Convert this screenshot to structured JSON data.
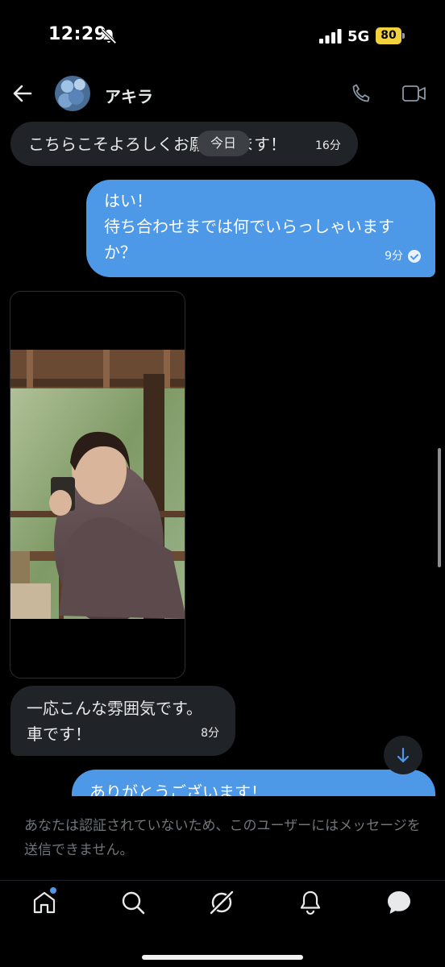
{
  "status_bar": {
    "time": "12:29",
    "network": "5G",
    "battery": "80",
    "mute_icon": "bell-slash-icon",
    "signal_icon": "cellular-signal-icon",
    "battery_color": "#f2d23c"
  },
  "header": {
    "contact_name": "アキラ",
    "back_icon": "arrow-left-icon",
    "call_icon": "phone-icon",
    "video_icon": "video-camera-icon"
  },
  "conversation": {
    "date_separator": "今日",
    "messages": [
      {
        "direction": "incoming",
        "text": "こちらこそよろしくお願いします！",
        "time": "16分"
      },
      {
        "direction": "outgoing",
        "lines": [
          "はい！",
          "待ち合わせまでは何でいらっしゃいます",
          "か？"
        ],
        "time": "9分",
        "read": true
      },
      {
        "direction": "incoming",
        "type": "image",
        "description_icon": "photo-attachment"
      },
      {
        "direction": "incoming",
        "lines": [
          "一応こんな雰囲気です。",
          "車です！"
        ],
        "time": "8分"
      },
      {
        "direction": "outgoing",
        "text": "ありがとうございます！"
      }
    ],
    "scroll_down_icon": "arrow-down-icon"
  },
  "notice": {
    "text": "あなたは認証されていないため、このユーザーにはメッセージを送信できません。"
  },
  "bottom_nav": {
    "items": [
      "home-icon",
      "search-icon",
      "grok-icon",
      "notifications-icon",
      "messages-icon"
    ],
    "active": "messages-icon"
  },
  "colors": {
    "background": "#000000",
    "incoming_bubble": "#202327",
    "outgoing_bubble": "#4e98e8",
    "accent": "#4e98e8",
    "muted_text": "#71767b"
  }
}
